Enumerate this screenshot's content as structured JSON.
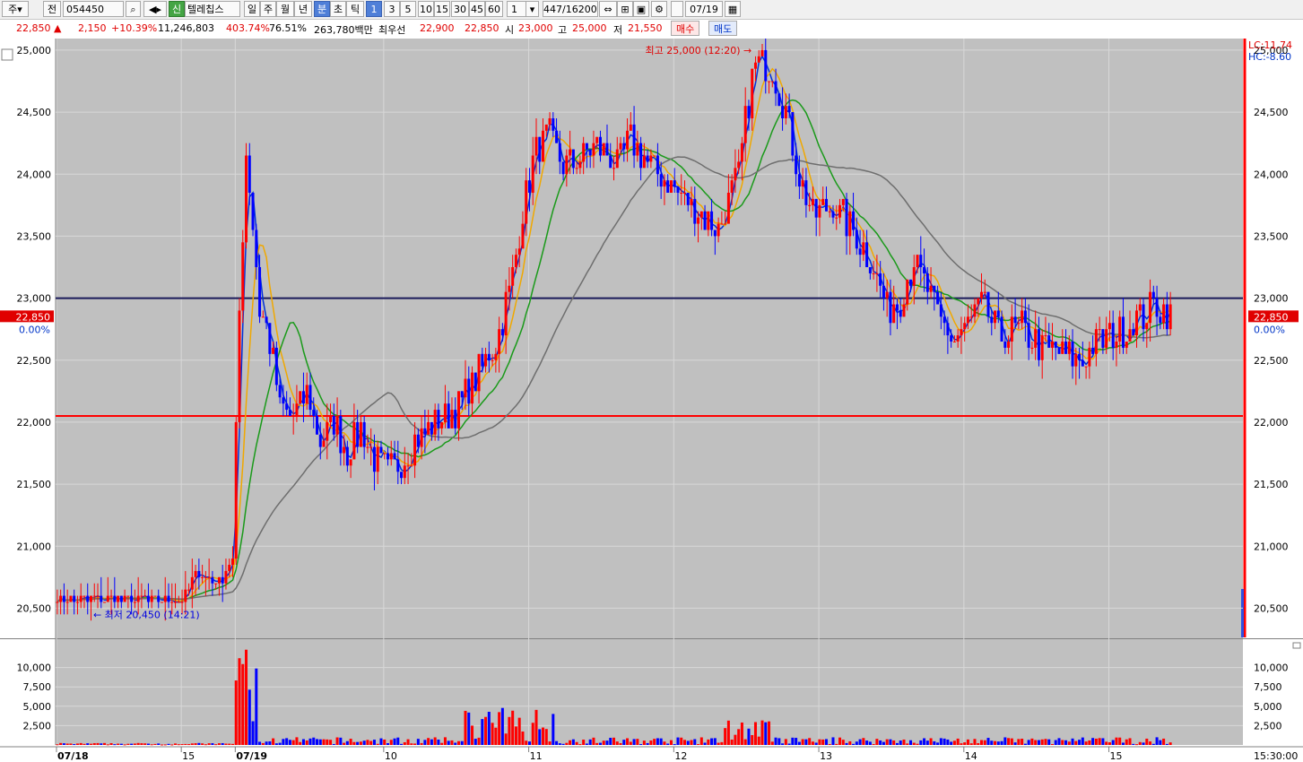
{
  "toolbar": {
    "type": "주",
    "market": "전",
    "code": "054450",
    "name": "텔레칩스",
    "badge": "신",
    "periods": [
      "일",
      "주",
      "월",
      "년",
      "분",
      "초",
      "틱"
    ],
    "intervals": [
      "1",
      "3",
      "5",
      "10",
      "15",
      "30",
      "45",
      "60"
    ],
    "unit": "1",
    "count": "447",
    "total": "/16200",
    "date": "07/19"
  },
  "quote": {
    "price": "22,850",
    "arrow": "▲",
    "change": "2,150",
    "pct": "+10.39%",
    "volume": "11,246,803",
    "vol_ratio": "403.74%",
    "turnover": "76.51%",
    "amount": "263,780백만",
    "best_ask_label": "최우선",
    "best_ask": "22,900",
    "best_bid": "22,850",
    "open_label": "시",
    "open": "23,000",
    "high_label": "고",
    "high": "25,000",
    "low_label": "저",
    "low": "21,550",
    "buy_label": "매수",
    "sell_label": "매도"
  },
  "chart_data": {
    "type": "candlestick",
    "y_ticks": [
      "25,000",
      "24,500",
      "24,000",
      "23,500",
      "23,000",
      "22,500",
      "22,000",
      "21,500",
      "21,000",
      "20,500"
    ],
    "ylim": [
      20250,
      25050
    ],
    "vol_ticks": [
      "10,000",
      "7,500",
      "5,000",
      "2,500"
    ],
    "vol_ylim": [
      0,
      12500
    ],
    "x_labels": [
      {
        "t": "07/18",
        "bar": 0
      },
      {
        "t": "15",
        "bar": 37
      },
      {
        "t": "07/19",
        "bar": 53
      },
      {
        "t": "10",
        "bar": 97
      },
      {
        "t": "11",
        "bar": 140
      },
      {
        "t": "12",
        "bar": 183
      },
      {
        "t": "13",
        "bar": 226
      },
      {
        "t": "14",
        "bar": 269
      },
      {
        "t": "15",
        "bar": 312
      }
    ],
    "bars_total": 352,
    "path": [
      [
        0,
        20570
      ],
      [
        37,
        20570
      ],
      [
        42,
        20800
      ],
      [
        48,
        20700
      ],
      [
        52,
        20900
      ],
      [
        54,
        22900
      ],
      [
        56,
        24200
      ],
      [
        58,
        23600
      ],
      [
        60,
        22900
      ],
      [
        62,
        22750
      ],
      [
        64,
        22500
      ],
      [
        66,
        22100
      ],
      [
        70,
        22050
      ],
      [
        74,
        22250
      ],
      [
        78,
        21850
      ],
      [
        82,
        22000
      ],
      [
        86,
        21750
      ],
      [
        90,
        21950
      ],
      [
        94,
        21700
      ],
      [
        98,
        21600
      ],
      [
        102,
        21700
      ],
      [
        106,
        21850
      ],
      [
        112,
        22000
      ],
      [
        118,
        22100
      ],
      [
        124,
        22350
      ],
      [
        130,
        22650
      ],
      [
        134,
        23050
      ],
      [
        138,
        23700
      ],
      [
        142,
        24200
      ],
      [
        146,
        24300
      ],
      [
        150,
        24050
      ],
      [
        156,
        24150
      ],
      [
        160,
        24250
      ],
      [
        166,
        24050
      ],
      [
        170,
        24300
      ],
      [
        176,
        24050
      ],
      [
        182,
        23900
      ],
      [
        188,
        23750
      ],
      [
        196,
        23550
      ],
      [
        202,
        24000
      ],
      [
        206,
        24800
      ],
      [
        208,
        24900
      ],
      [
        212,
        24850
      ],
      [
        216,
        24500
      ],
      [
        220,
        24000
      ],
      [
        224,
        23650
      ],
      [
        230,
        23750
      ],
      [
        236,
        23550
      ],
      [
        242,
        23250
      ],
      [
        246,
        22900
      ],
      [
        250,
        23000
      ],
      [
        254,
        23300
      ],
      [
        258,
        23050
      ],
      [
        262,
        22800
      ],
      [
        266,
        22650
      ],
      [
        270,
        22800
      ],
      [
        274,
        22950
      ],
      [
        280,
        22700
      ],
      [
        286,
        22750
      ],
      [
        292,
        22600
      ],
      [
        298,
        22550
      ],
      [
        304,
        22500
      ],
      [
        308,
        22650
      ],
      [
        314,
        22700
      ],
      [
        318,
        22800
      ],
      [
        322,
        22850
      ],
      [
        326,
        22950
      ],
      [
        330,
        22850
      ]
    ],
    "ma": [
      {
        "name": "MA5",
        "color": "#0030d8",
        "lag": 2
      },
      {
        "name": "MA10",
        "color": "#f0a800",
        "lag": 6
      },
      {
        "name": "MA20",
        "color": "#1a9a1a",
        "lag": 16
      },
      {
        "name": "MA60",
        "color": "#6e6e6e",
        "lag": 45
      }
    ],
    "hlines": [
      {
        "value": 23000,
        "color": "#1a1a5a"
      },
      {
        "value": 22050,
        "color": "#ff0000"
      }
    ],
    "annotations": {
      "high": "최고 25,000 (12:20)",
      "low": "최저 20,450 (14:21)",
      "left_price": "22,850",
      "left_pct": "0.00%",
      "right_price": "22,850",
      "right_pct": "0.00%",
      "lc": "LC:11.74",
      "hc": "HC:-8.60",
      "close_time": "15:30:00"
    },
    "colors": {
      "up": "#ff0000",
      "down": "#0000ff",
      "bg": "#c0c0c0"
    }
  }
}
